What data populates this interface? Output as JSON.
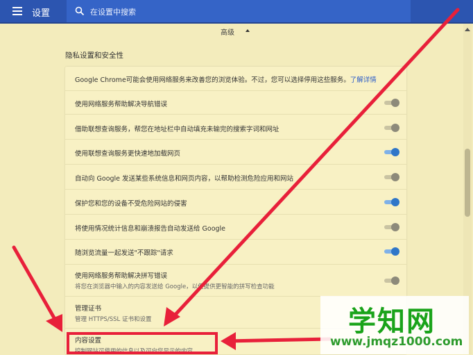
{
  "header": {
    "title": "设置",
    "search_placeholder": "在设置中搜索"
  },
  "advanced": {
    "label": "高级"
  },
  "privacy": {
    "section_title": "隐私设置和安全性",
    "intro_text": "Google Chrome可能会使用网络服务来改善您的浏览体验。不过，您可以选择停用这些服务。",
    "intro_link": "了解详情",
    "items": [
      {
        "label": "使用网络服务帮助解决导航错误",
        "on": false
      },
      {
        "label": "借助联想查询服务，帮您在地址栏中自动填充未输完的搜索字词和网址",
        "on": false
      },
      {
        "label": "使用联想查询服务更快速地加载网页",
        "on": true
      },
      {
        "label": "自动向 Google 发送某些系统信息和网页内容，以帮助检测危险应用和网站",
        "on": false
      },
      {
        "label": "保护您和您的设备不受危险网站的侵害",
        "on": true
      },
      {
        "label": "将使用情况统计信息和崩溃报告自动发送给 Google",
        "on": false
      },
      {
        "label": "随浏览流量一起发送\"不跟踪\"请求",
        "on": true
      },
      {
        "label": "使用网络服务帮助解决拼写错误",
        "sub": "将您在浏览器中输入的内容发送给 Google，以便提供更智能的拼写检查功能",
        "on": false
      }
    ],
    "certificates": {
      "label": "管理证书",
      "sub": "管理 HTTPS/SSL 证书和设置"
    },
    "content_settings": {
      "label": "内容设置",
      "sub": "控制网站可使用的信息以及可向您显示的内容"
    }
  },
  "watermark": {
    "title": "学知网",
    "url": "www.jmqz1000.com"
  },
  "colors": {
    "header_bg": "#2c55b0",
    "page_bg": "#f3ecbc",
    "arrow": "#e8203a",
    "toggle_on": "#2f76c8",
    "watermark_green": "#1aa31a"
  }
}
